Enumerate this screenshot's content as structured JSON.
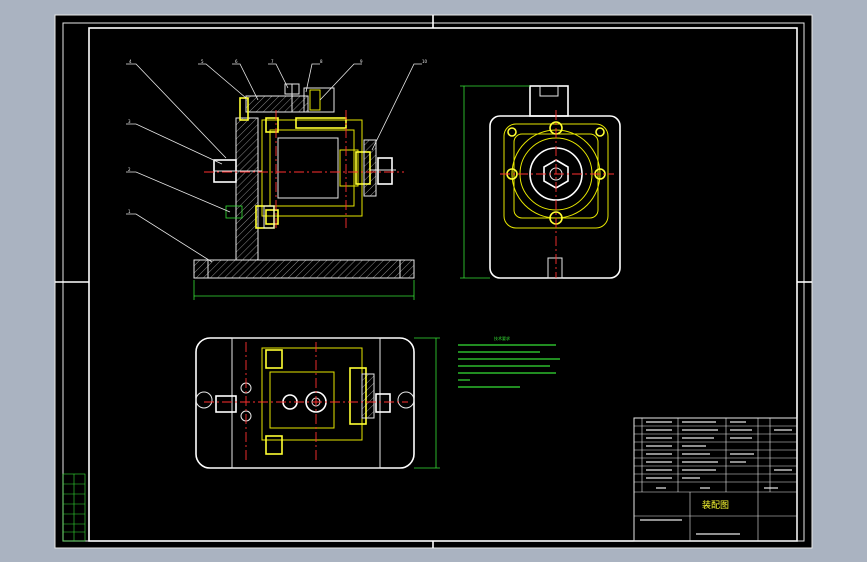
{
  "drawing": {
    "title_block_name": "装配图",
    "notes_heading": "技术要求",
    "balloons": [
      "4",
      "5",
      "6",
      "7",
      "8",
      "9",
      "3",
      "2",
      "1",
      "10"
    ]
  },
  "colors": {
    "background_outer": "#aab3c1",
    "sheet": "#000000",
    "outline": "#e8e8e8",
    "part_edge": "#e6e600",
    "center_line": "#ff3030",
    "dimension": "#35e035",
    "title_text": "#ffff33"
  }
}
